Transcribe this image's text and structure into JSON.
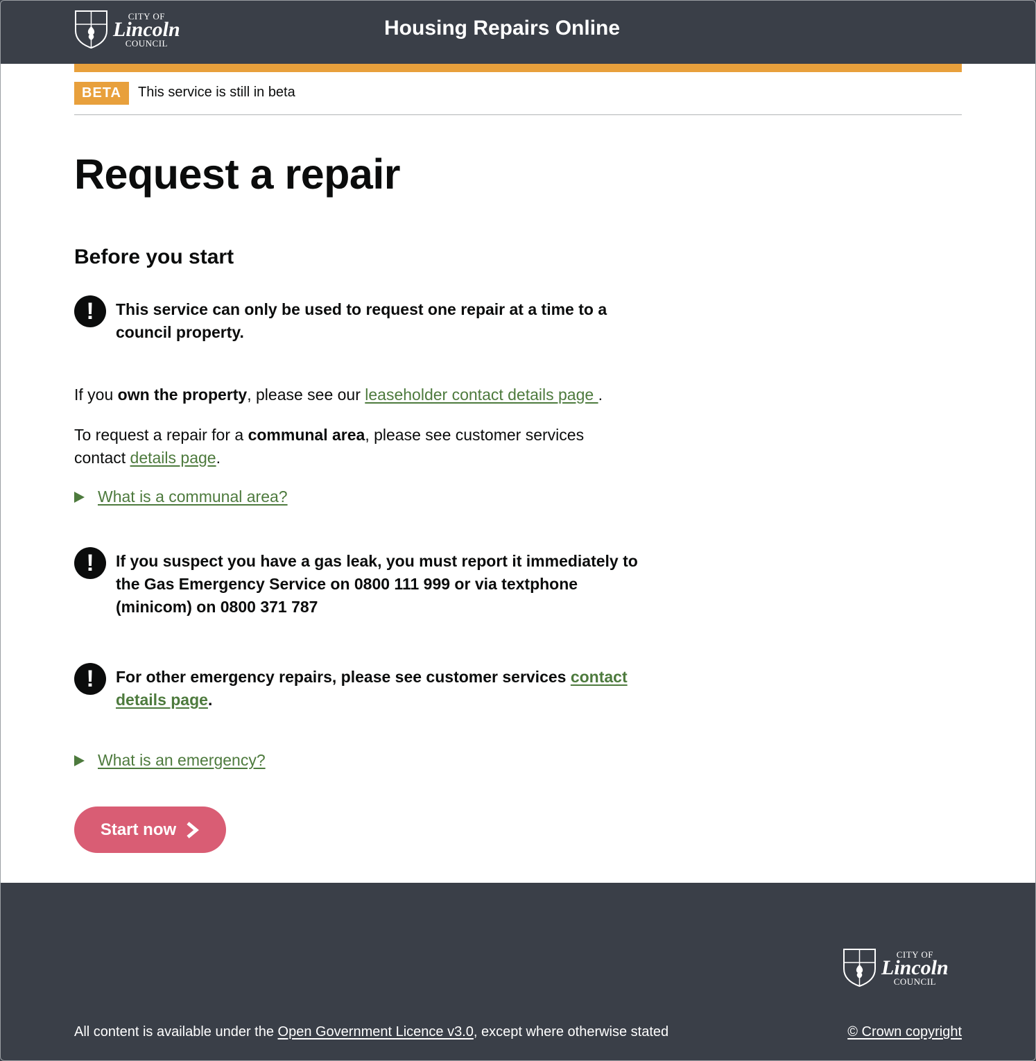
{
  "header": {
    "logo": {
      "line1": "CITY OF",
      "line2": "Lincoln",
      "line3": "COUNCIL"
    },
    "service_name": "Housing Repairs Online"
  },
  "phase_banner": {
    "tag": "BETA",
    "text": "This service is still in beta"
  },
  "main": {
    "title": "Request a repair",
    "subtitle": "Before you start",
    "warning_one": "This service can only be used to request one repair at a time to a council property.",
    "own_property": {
      "prefix": "If you ",
      "bold": "own the property",
      "middle": ", please see our ",
      "link": "leaseholder contact details page ",
      "suffix": "."
    },
    "communal": {
      "prefix": "To request a repair for a ",
      "bold": "communal area",
      "middle": ", please see customer services contact ",
      "link": "details page",
      "suffix": "."
    },
    "details_communal": "What is a communal area?",
    "warning_gas": "If you suspect you have a gas leak, you must report it immediately to the Gas Emergency Service on 0800 111 999 or via textphone (minicom) on 0800 371 787",
    "warning_other": {
      "text": "For other emergency repairs, please see customer services ",
      "link": "contact details page",
      "suffix": "."
    },
    "details_emergency": "What is an emergency?",
    "start_button": "Start now"
  },
  "footer": {
    "logo": {
      "line1": "CITY OF",
      "line2": "Lincoln",
      "line3": "COUNCIL"
    },
    "licence_prefix": "All content is available under the ",
    "licence_link": "Open Government Licence v3.0",
    "licence_suffix": ", except where otherwise stated",
    "copyright": "© Crown copyright"
  },
  "colors": {
    "header_bg": "#3a3f48",
    "accent_orange": "#e8a03c",
    "link_green": "#4d7a3d",
    "button_pink": "#d95d74"
  }
}
